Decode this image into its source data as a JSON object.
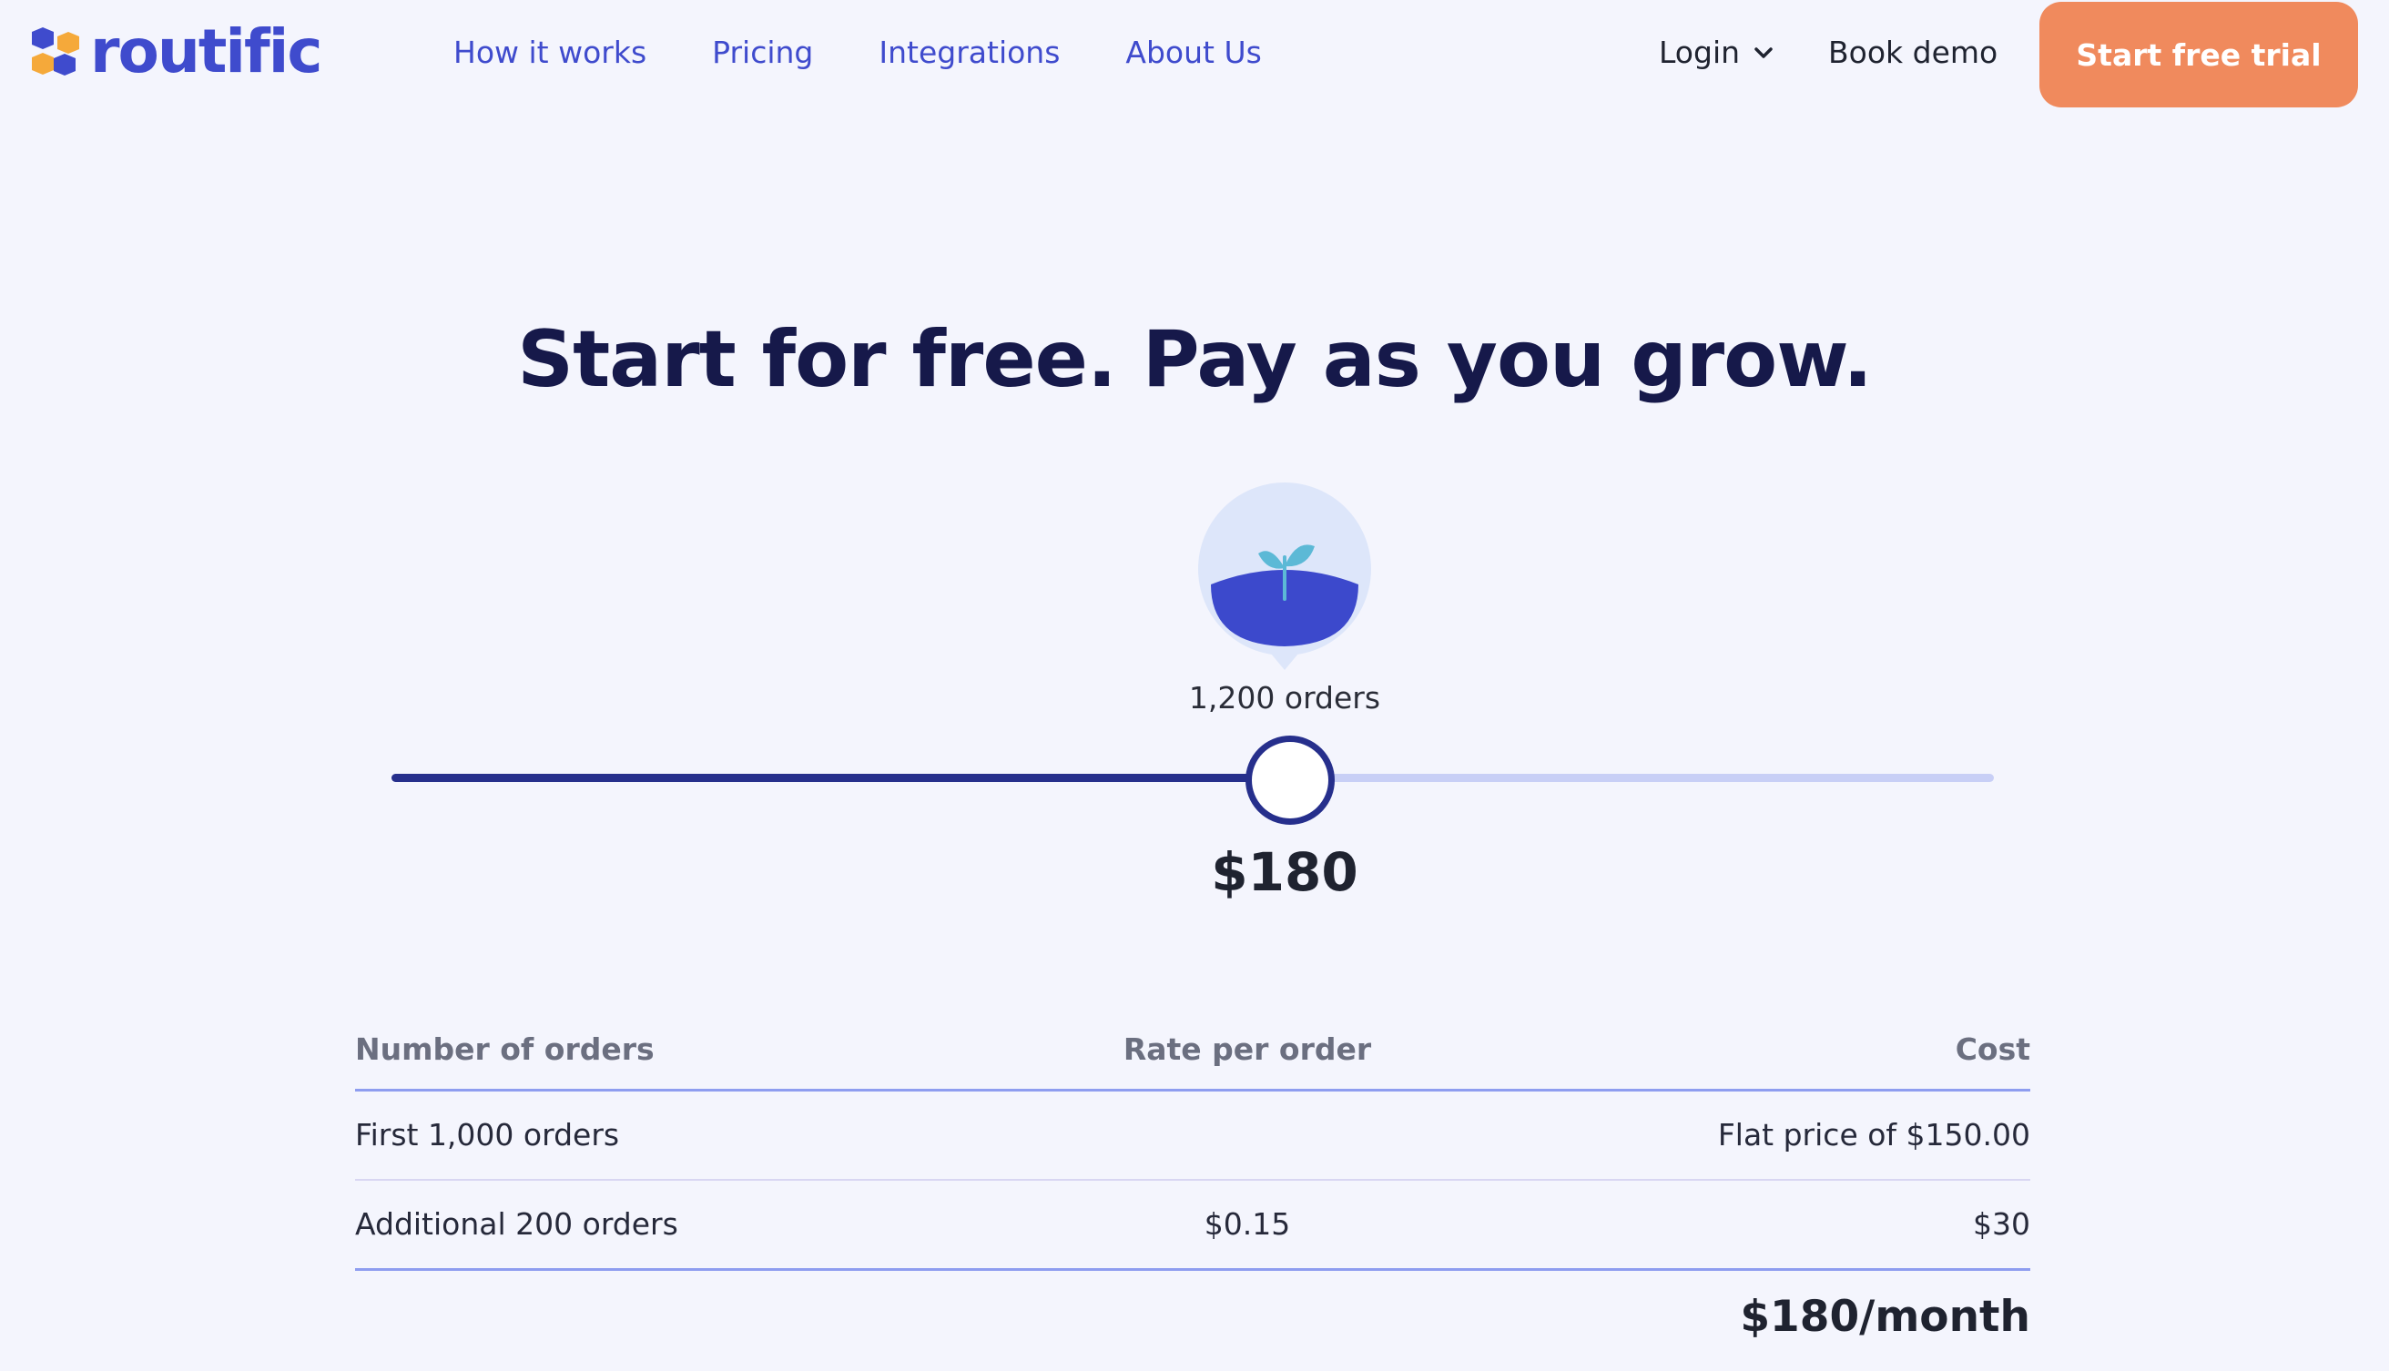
{
  "brand": {
    "name": "routific",
    "colors": {
      "primary": "#3f4bcd",
      "accent": "#f08a5d",
      "navy": "#16194a",
      "logo_blue": "#3f4bcd",
      "logo_orange": "#f5a93a"
    }
  },
  "nav": {
    "links": [
      "How it works",
      "Pricing",
      "Integrations",
      "About Us"
    ],
    "login_label": "Login",
    "login_icon": "chevron-down-icon",
    "book_demo_label": "Book demo",
    "cta_label": "Start free trial"
  },
  "hero": {
    "headline": "Start for free. Pay as you grow.",
    "badge_icon": "seedling-icon"
  },
  "slider": {
    "value_fraction": 0.56,
    "orders_label": "1,200 orders",
    "price_label": "$180"
  },
  "pricing_table": {
    "columns": [
      "Number of orders",
      "Rate per order",
      "Cost"
    ],
    "rows": [
      [
        "First 1,000 orders",
        "",
        "Flat price of $150.00"
      ],
      [
        "Additional 200 orders",
        "$0.15",
        "$30"
      ]
    ],
    "total": "$180/month"
  }
}
